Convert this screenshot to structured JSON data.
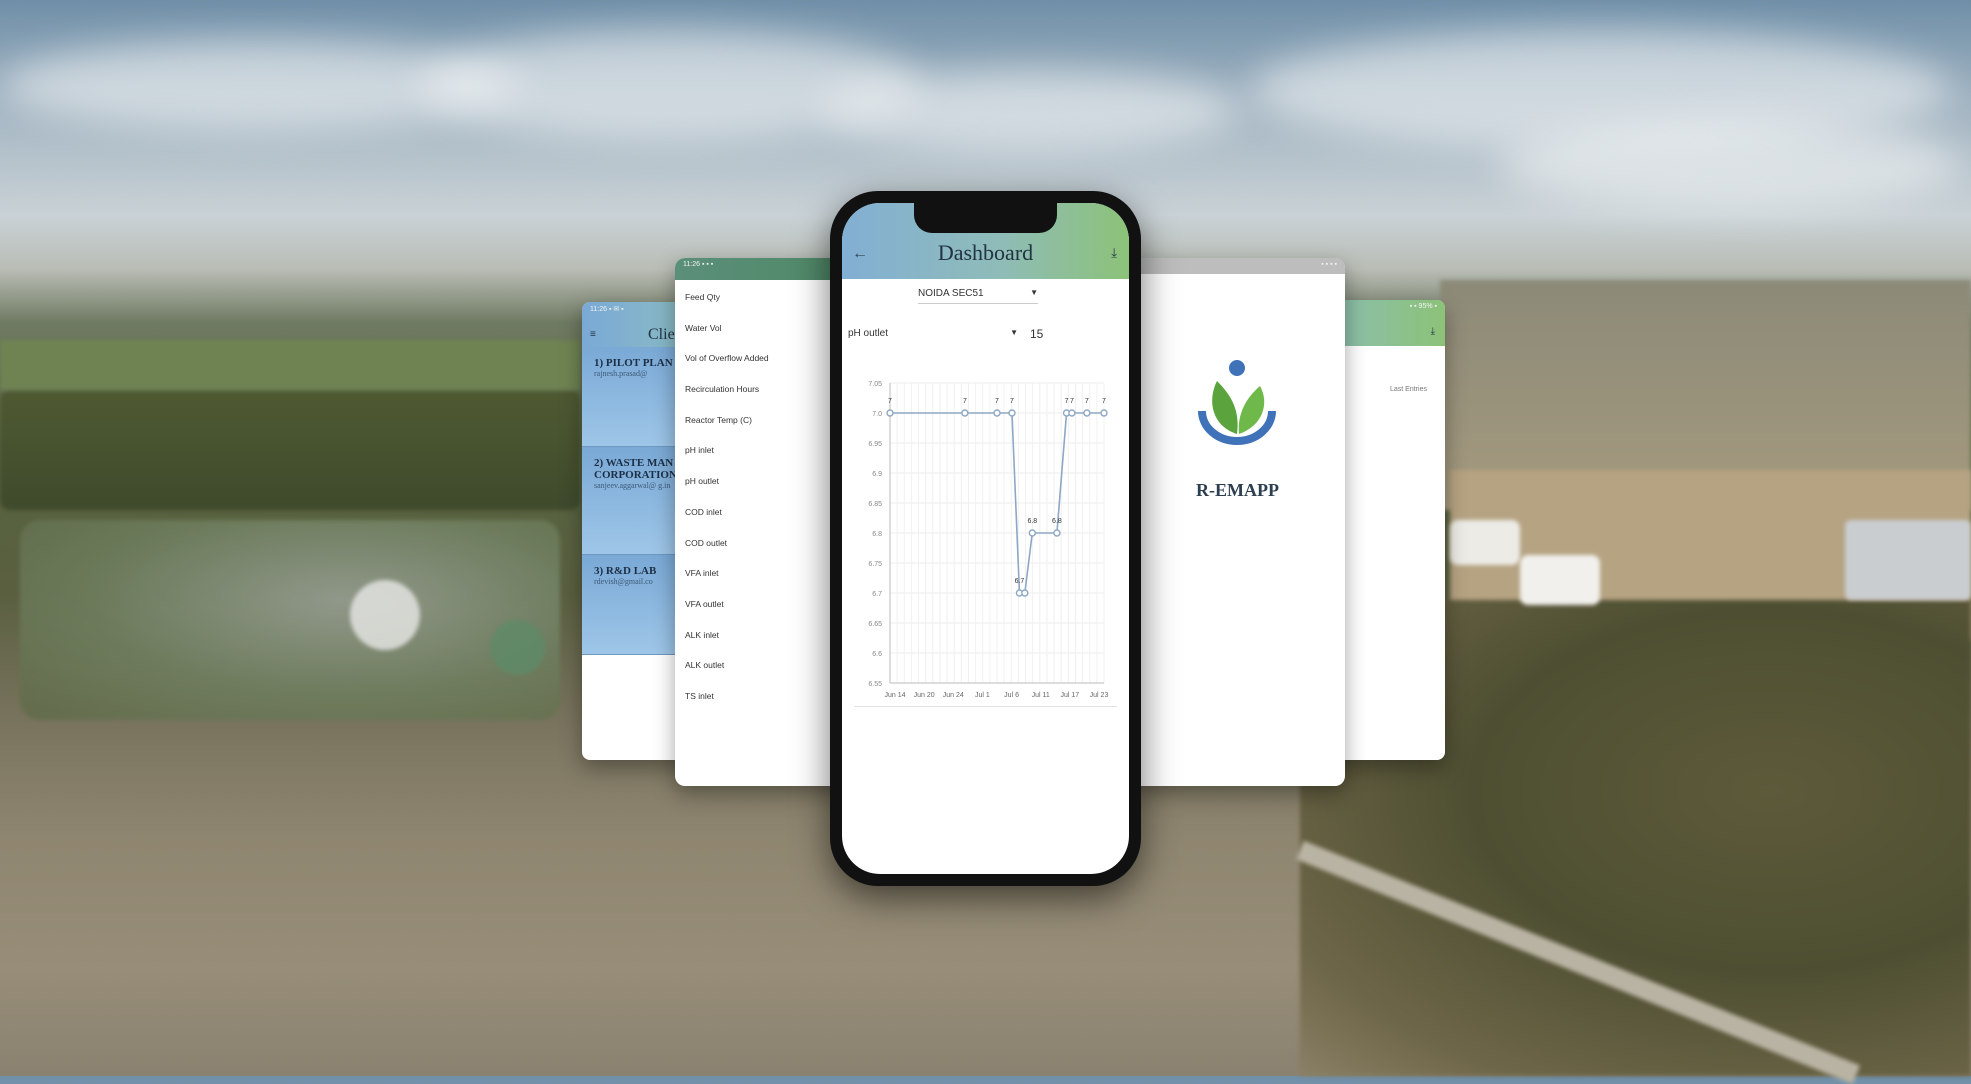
{
  "left_app": {
    "title_partial": "Clie",
    "clients": [
      {
        "name": "1) PILOT PLAN",
        "contact": "rajnesh.prasad@"
      },
      {
        "name": "2) WASTE MAN CORPORATION",
        "contact": "sanjeev.aggarwal@ g.in"
      },
      {
        "name": "3) R&D LAB",
        "contact": "rdevish@gmail.co"
      }
    ]
  },
  "parameter_list": {
    "items": [
      "Feed Qty",
      "Water Vol",
      "Vol of Overflow Added",
      "Recirculation Hours",
      "Reactor Temp (C)",
      "pH inlet",
      "pH outlet",
      "COD inlet",
      "COD outlet",
      "VFA inlet",
      "VFA outlet",
      "ALK inlet",
      "ALK outlet",
      "TS inlet"
    ]
  },
  "dashboard": {
    "title": "Dashboard",
    "site_select": "NOIDA SEC51",
    "parameter_select": "pH outlet",
    "days_select": "15"
  },
  "chart_data": {
    "type": "line",
    "title": "",
    "xlabel": "",
    "ylabel": "",
    "ylim": [
      6.55,
      7.05
    ],
    "yticks": [
      "7.05",
      "7.0",
      "6.95",
      "6.9",
      "6.85",
      "6.8",
      "6.75",
      "6.7",
      "6.65",
      "6.6",
      "6.55"
    ],
    "xticks": [
      "Jun 14",
      "Jun 20",
      "Jun 24",
      "Jul 1",
      "Jul 6",
      "Jul 11",
      "Jul 17",
      "Jul 23"
    ],
    "series": [
      {
        "values": [
          {
            "x": 0.0,
            "y": 7.0,
            "label": "7"
          },
          {
            "x": 0.35,
            "y": 7.0,
            "label": "7"
          },
          {
            "x": 0.5,
            "y": 7.0,
            "label": "7"
          },
          {
            "x": 0.57,
            "y": 7.0,
            "label": "7"
          },
          {
            "x": 0.605,
            "y": 6.7,
            "label": "6.7"
          },
          {
            "x": 0.63,
            "y": 6.7,
            "label": ""
          },
          {
            "x": 0.665,
            "y": 6.8,
            "label": "6.8"
          },
          {
            "x": 0.78,
            "y": 6.8,
            "label": "6.8"
          },
          {
            "x": 0.825,
            "y": 7.0,
            "label": "7"
          },
          {
            "x": 0.85,
            "y": 7.0,
            "label": "7"
          },
          {
            "x": 0.92,
            "y": 7.0,
            "label": "7"
          },
          {
            "x": 1.0,
            "y": 7.0,
            "label": "7"
          }
        ]
      }
    ]
  },
  "splash": {
    "app_name": "R-EMAPP"
  },
  "right_app": {
    "hint_partial": "Last Entries"
  },
  "colors": {
    "header_blue": "#82afd4",
    "header_green": "#8cc278",
    "line": "#8ea7c4"
  }
}
